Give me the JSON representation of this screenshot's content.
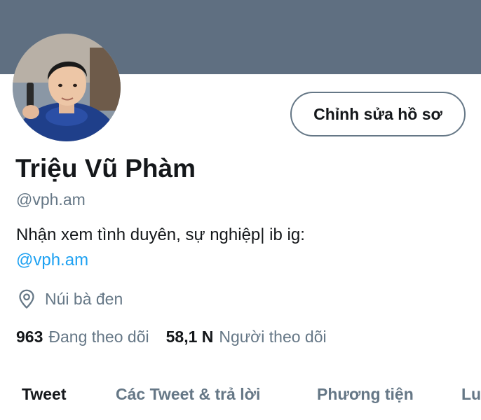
{
  "profile": {
    "display_name": "Triệu Vũ Phàm",
    "handle": "@vph.am",
    "bio_text": "Nhận xem tình duyên, sự nghiệp| ib ig:",
    "bio_link": "@vph.am",
    "location": "Núi bà đen",
    "edit_button_label": "Chỉnh sửa hồ sơ"
  },
  "stats": {
    "following_count": "963",
    "following_label": "Đang theo dõi",
    "followers_count": "58,1 N",
    "followers_label": "Người theo dõi"
  },
  "tabs": [
    {
      "label": "Tweet",
      "active": true
    },
    {
      "label": "Các Tweet & trả lời",
      "active": false
    },
    {
      "label": "Phương tiện",
      "active": false
    },
    {
      "label": "Lu",
      "active": false
    }
  ],
  "colors": {
    "banner": "#5f6f81",
    "link": "#1da1f2",
    "secondary_text": "#657786"
  }
}
